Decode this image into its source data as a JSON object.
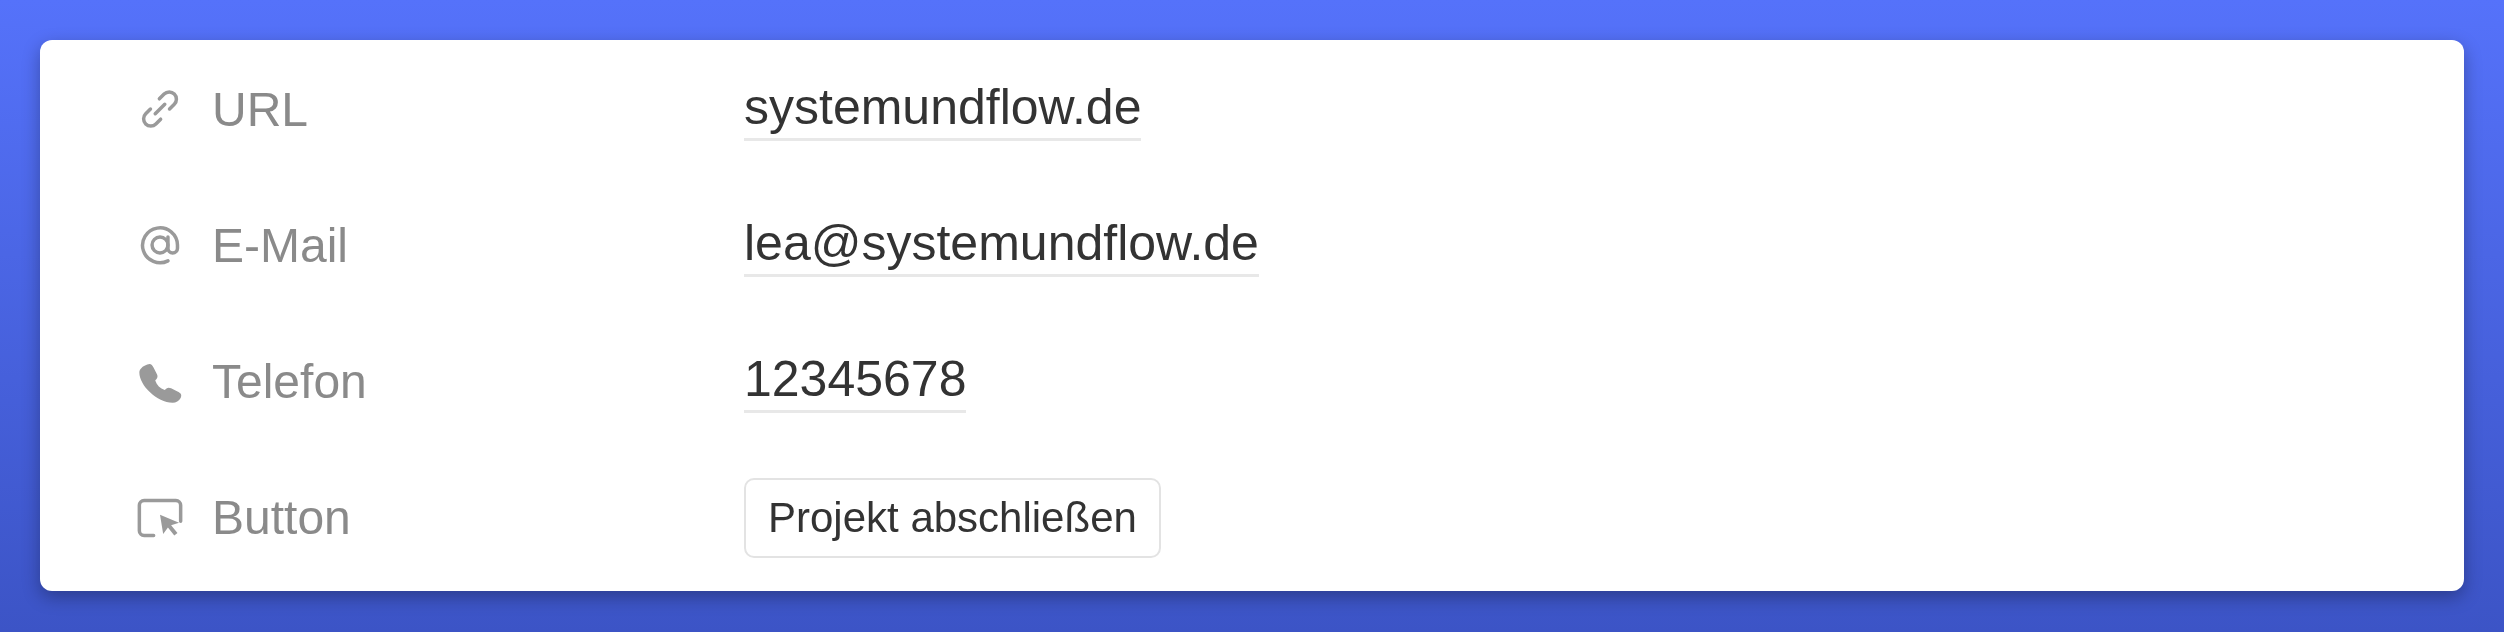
{
  "properties": [
    {
      "label": "URL",
      "kind": "text",
      "value": "systemundflow.de"
    },
    {
      "label": "E-Mail",
      "kind": "text",
      "value": "lea@systemundflow.de"
    },
    {
      "label": "Telefon",
      "kind": "text",
      "value": "12345678"
    },
    {
      "label": "Button",
      "kind": "button",
      "value": "Projekt abschließen"
    }
  ]
}
